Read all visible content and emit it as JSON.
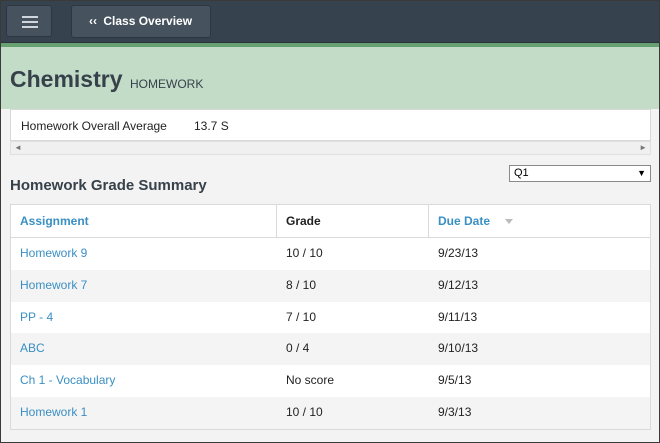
{
  "nav": {
    "menu_icon": "hamburger-menu-icon",
    "back_chevron": "‹‹",
    "back_label": "Class Overview"
  },
  "course": {
    "title": "Chemistry",
    "subtitle": "HOMEWORK"
  },
  "average": {
    "label": "Homework Overall Average",
    "value": "13.7 S"
  },
  "scrollbar": {
    "left": "◄",
    "right": "►"
  },
  "filter": {
    "selected": "Q1",
    "caret": "▼"
  },
  "summary": {
    "title": "Homework Grade Summary",
    "columns": [
      "Assignment",
      "Grade",
      "Due Date"
    ],
    "sorted_column": "Due Date",
    "rows": [
      {
        "assignment": "Homework 9",
        "grade": "10 / 10",
        "due": "9/23/13"
      },
      {
        "assignment": "Homework 7",
        "grade": "8 / 10",
        "due": "9/12/13"
      },
      {
        "assignment": "PP - 4",
        "grade": "7 / 10",
        "due": "9/11/13"
      },
      {
        "assignment": "ABC",
        "grade": "0 / 4",
        "due": "9/10/13"
      },
      {
        "assignment": "Ch 1 - Vocabulary",
        "grade": "No score",
        "due": "9/5/13"
      },
      {
        "assignment": "Homework 1",
        "grade": "10 / 10",
        "due": "9/3/13"
      }
    ]
  },
  "colors": {
    "topbar": "#36434f",
    "accent": "#67a071",
    "hero": "#c2dcc8",
    "link": "#3a8fc4"
  }
}
